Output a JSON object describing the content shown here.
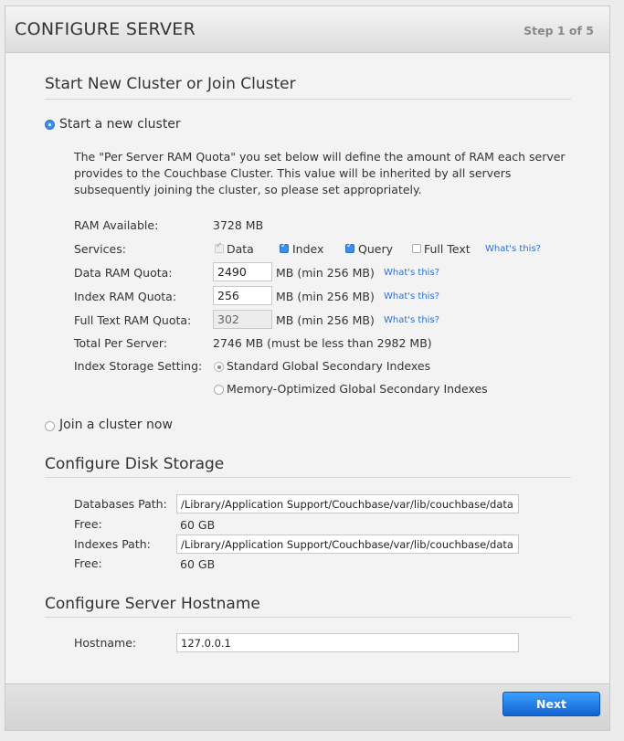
{
  "header": {
    "title": "CONFIGURE SERVER",
    "step": "Step 1 of 5"
  },
  "cluster_section": {
    "title": "Start New Cluster or Join Cluster",
    "start_option": "Start a new cluster",
    "description": "The \"Per Server RAM Quota\" you set below will define the amount of RAM each server provides to the Couchbase Cluster. This value will be inherited by all servers subsequently joining the cluster, so please set appropriately.",
    "ram_available_label": "RAM Available:",
    "ram_available_value": "3728 MB",
    "services_label": "Services:",
    "services": {
      "data": "Data",
      "index": "Index",
      "query": "Query",
      "fulltext": "Full Text"
    },
    "whats_this": "What's this?",
    "data_quota_label": "Data RAM Quota:",
    "data_quota_value": "2490",
    "index_quota_label": "Index RAM Quota:",
    "index_quota_value": "256",
    "fts_quota_label": "Full Text RAM Quota:",
    "fts_quota_value": "302",
    "quota_min": "MB (min 256 MB)",
    "total_label": "Total Per Server:",
    "total_value": "2746 MB (must be less than 2982 MB)",
    "storage_label": "Index Storage Setting:",
    "storage_standard": "Standard Global Secondary Indexes",
    "storage_memopt": "Memory-Optimized Global Secondary Indexes",
    "join_option": "Join a cluster now"
  },
  "disk_section": {
    "title": "Configure Disk Storage",
    "db_path_label": "Databases Path:",
    "db_path_value": "/Library/Application Support/Couchbase/var/lib/couchbase/data",
    "free_label": "Free:",
    "db_free_value": "60 GB",
    "idx_path_label": "Indexes Path:",
    "idx_path_value": "/Library/Application Support/Couchbase/var/lib/couchbase/data",
    "idx_free_value": "60 GB"
  },
  "hostname_section": {
    "title": "Configure Server Hostname",
    "hostname_label": "Hostname:",
    "hostname_value": "127.0.0.1"
  },
  "footer": {
    "next_label": "Next"
  },
  "colors": {
    "accent": "#3b8fe8",
    "link": "#2a72c9"
  }
}
